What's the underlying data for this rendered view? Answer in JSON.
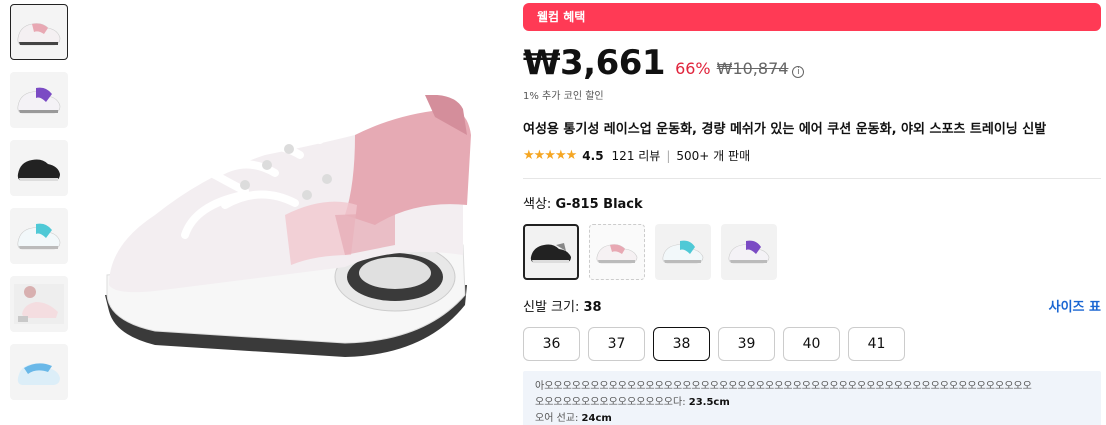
{
  "thumbnails": [
    {
      "icon": "shoe-pink-icon",
      "color": "#e8a8b3"
    },
    {
      "icon": "shoe-purple-icon",
      "color": "#7b4bc4"
    },
    {
      "icon": "shoe-black-icon",
      "color": "#222222"
    },
    {
      "icon": "shoe-cyan-icon",
      "color": "#4fc9d6"
    },
    {
      "icon": "shoe-lifestyle-icon",
      "color": "#d8b0b0"
    },
    {
      "icon": "shoe-blue-icon",
      "color": "#6ab8e8"
    }
  ],
  "banner": {
    "label": "웰컴 혜택"
  },
  "price": {
    "current": "₩3,661",
    "discount": "66%",
    "original": "₩10,874",
    "info_icon": "i"
  },
  "coin_text": "1% 추가 코인 할인",
  "product_title": "여성용 통기성 레이스업 운동화, 경량 메쉬가 있는 에어 쿠션 운동화, 야외 스포츠 트레이닝 신발",
  "rating": {
    "stars": "★★★★★",
    "value": "4.5",
    "reviews": "121 리뷰",
    "sold": "500+ 개 판매"
  },
  "color": {
    "label": "색상: ",
    "selected": "G-815 Black",
    "options": [
      {
        "icon": "shoe-black-icon",
        "color": "#222222"
      },
      {
        "icon": "shoe-pink-icon",
        "color": "#e8a8b3"
      },
      {
        "icon": "shoe-cyan-icon",
        "color": "#4fc9d6"
      },
      {
        "icon": "shoe-purple-icon",
        "color": "#7b4bc4"
      }
    ]
  },
  "size": {
    "label": "신발 크기: ",
    "selected": "38",
    "chart_label": "사이즈 표",
    "options": [
      "36",
      "37",
      "38",
      "39",
      "40",
      "41"
    ]
  },
  "note": {
    "line1": "아오오오오오오오오오오오오오오오오오오오오오오오오오오오오오오오오오오오오오오오오오오오오오오오오오오오오오",
    "line2": "오오오오오오오오오오오오오오오다: ",
    "line2_value": "23.5cm",
    "line3": "오어 선교: ",
    "line3_value": "24cm"
  },
  "colors": {
    "accent": "#ff3a55",
    "discount": "#e0233b",
    "link": "#1a66d2",
    "star": "#f5a623"
  }
}
